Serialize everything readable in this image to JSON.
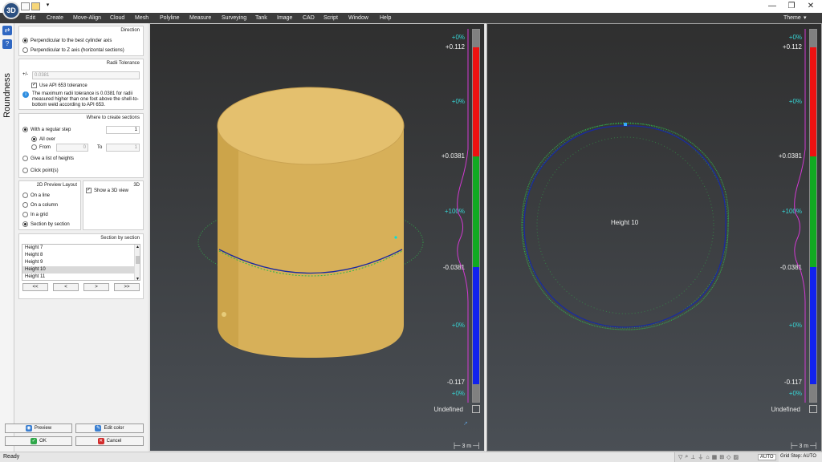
{
  "menu": [
    "Edit",
    "Create",
    "Move-Align",
    "Cloud",
    "Mesh",
    "Polyline",
    "Measure",
    "Surveying",
    "Tank",
    "Image",
    "CAD",
    "Script",
    "Window",
    "Help"
  ],
  "theme_label": "Theme",
  "vertical_title": "Roundness",
  "direction": {
    "title": "Direction",
    "opt1": "Perpendicular to the best cylinder axis",
    "opt2": "Perpendicular to Z axis (horizontal sections)",
    "selected": 1
  },
  "radii": {
    "title": "Radii Tolerance",
    "prefix": "+/-",
    "value": "0.0381",
    "use_api_label": "Use API 653 tolerance",
    "use_api_checked": true,
    "info": "The maximum radii tolerance is 0.0381 for radii measured higher than one foot above the shell-to-bottom weld according to API 653."
  },
  "sections": {
    "title": "Where to create sections",
    "regular_step": "With a regular step",
    "step_value": "1",
    "all_over": "All over",
    "from_label": "From",
    "from_value": "0",
    "to_label": "To",
    "to_value": "1",
    "list_heights": "Give a list of heights",
    "click_points": "Click point(s)"
  },
  "preview_layout": {
    "title": "2D Preview Layout",
    "on_line": "On a line",
    "on_column": "On a column",
    "in_grid": "In a grid",
    "section_by_section": "Section by section"
  },
  "view3d": {
    "title": "3D",
    "show_label": "Show a 3D view",
    "checked": true
  },
  "section_list": {
    "title": "Section by section",
    "items": [
      "Height 7",
      "Height 8",
      "Height 9",
      "Height 10",
      "Height 11"
    ],
    "selected": "Height 10",
    "nav": [
      "<<",
      "<",
      ">",
      ">>"
    ]
  },
  "buttons": {
    "preview": "Preview",
    "edit_color": "Edit color",
    "ok": "OK",
    "cancel": "Cancel"
  },
  "colorscale": {
    "labels": [
      "+0%",
      "+0.112",
      "+0%",
      "+0.0381",
      "+100%",
      "-0.0381",
      "+0%",
      "-0.117",
      "+0%"
    ],
    "undefined_label": "Undefined",
    "colors": {
      "red": "#ee1111",
      "green": "#11aa22",
      "blue": "#1122ee",
      "gray": "#808080"
    }
  },
  "scale_text": "3 m",
  "height_label": "Height 10",
  "status": {
    "ready": "Ready",
    "auto": "AUTO",
    "grid_step": "Grid Step: AUTO"
  }
}
